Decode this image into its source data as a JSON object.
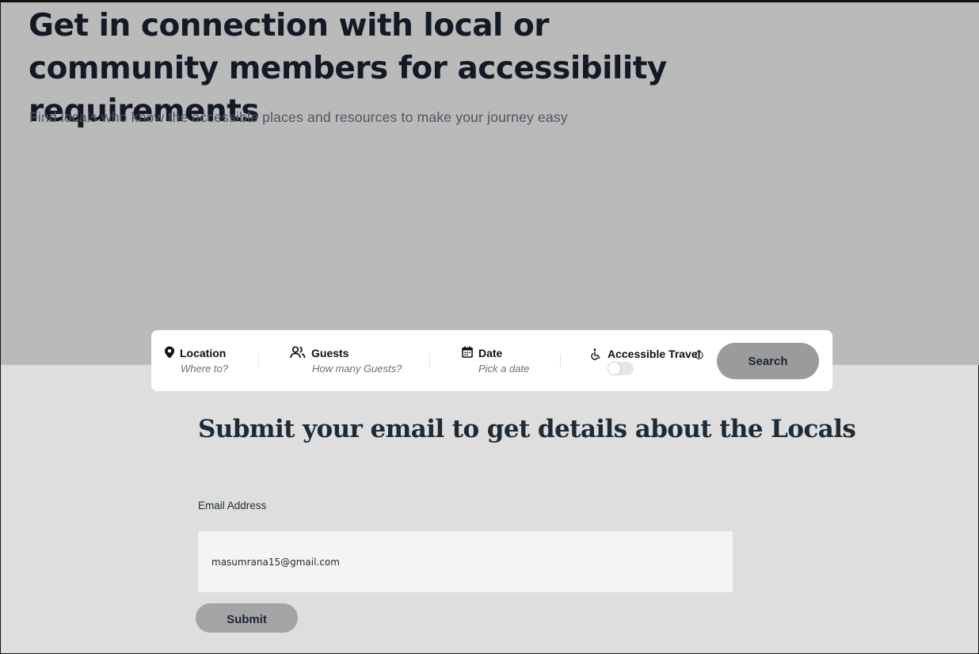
{
  "hero": {
    "title": "Get in connection with local or community members for accessibility requirements",
    "subtitle": "Find locals who know the accessible places and resources to make your journey easy"
  },
  "search_bar": {
    "location": {
      "label": "Location",
      "placeholder": "Where to?",
      "icon": "map-pin-icon"
    },
    "guests": {
      "label": "Guests",
      "placeholder": "How many Guests?",
      "icon": "users-icon"
    },
    "date": {
      "label": "Date",
      "placeholder": "Pick a date",
      "icon": "calendar-icon"
    },
    "accessible_travel": {
      "label": "Accessible Travel",
      "icon": "wheelchair-icon",
      "info_icon": "info-icon",
      "enabled": false
    },
    "search_button": "Search"
  },
  "email_section": {
    "title": "Submit your email to get details about the Locals",
    "email_label": "Email Address",
    "email_value": "masumrana15@gmail.com",
    "submit_button": "Submit"
  },
  "colors": {
    "hero_bg": "#bababa",
    "page_bg": "#dedede",
    "heading": "#131a26",
    "button_bg": "#9b9b9b"
  }
}
